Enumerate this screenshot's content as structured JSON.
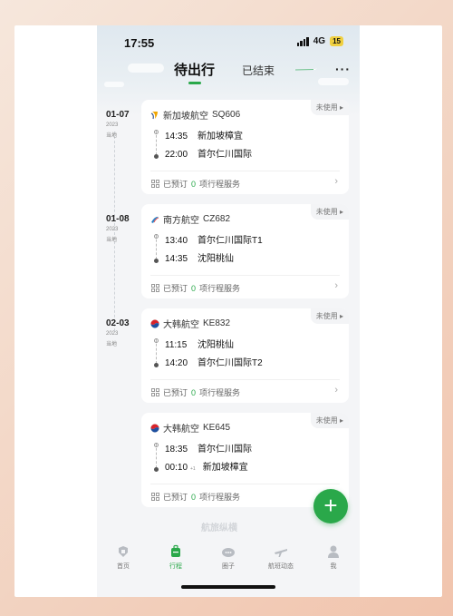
{
  "status": {
    "time": "17:55",
    "network": "4G",
    "battery": "15"
  },
  "tabs": {
    "active": "待出行",
    "inactive": "已结束"
  },
  "days": [
    {
      "date": "01-07",
      "year": "2023",
      "local": "当地"
    },
    {
      "date": "01-08",
      "year": "2023",
      "local": "当地"
    },
    {
      "date": "02-03",
      "year": "2023",
      "local": "当地"
    }
  ],
  "trips": [
    {
      "airline": "新加坡航空",
      "flight_no": "SQ606",
      "status": "未使用",
      "dep_time": "14:35",
      "dep_airport": "新加坡樟宜",
      "arr_time": "22:00",
      "arr_airport": "首尔仁川国际",
      "plus_day": "",
      "booked_label": "已预订",
      "booked_count": "0",
      "service_label": "项行程服务"
    },
    {
      "airline": "南方航空",
      "flight_no": "CZ682",
      "status": "未使用",
      "dep_time": "13:40",
      "dep_airport": "首尔仁川国际T1",
      "arr_time": "14:35",
      "arr_airport": "沈阳桃仙",
      "plus_day": "",
      "booked_label": "已预订",
      "booked_count": "0",
      "service_label": "项行程服务"
    },
    {
      "airline": "大韩航空",
      "flight_no": "KE832",
      "status": "未使用",
      "dep_time": "11:15",
      "dep_airport": "沈阳桃仙",
      "arr_time": "14:20",
      "arr_airport": "首尔仁川国际T2",
      "plus_day": "",
      "booked_label": "已预订",
      "booked_count": "0",
      "service_label": "项行程服务"
    },
    {
      "airline": "大韩航空",
      "flight_no": "KE645",
      "status": "未使用",
      "dep_time": "18:35",
      "dep_airport": "首尔仁川国际",
      "arr_time": "00:10",
      "arr_airport": "新加坡樟宜",
      "plus_day": "+1",
      "booked_label": "已预订",
      "booked_count": "0",
      "service_label": "项行程服务"
    }
  ],
  "watermark": "航旅纵横",
  "fab": "+",
  "bottom_nav": [
    {
      "label": "首页",
      "icon": "home-icon"
    },
    {
      "label": "行程",
      "icon": "luggage-icon"
    },
    {
      "label": "圈子",
      "icon": "circle-icon"
    },
    {
      "label": "航班动态",
      "icon": "plane-icon"
    },
    {
      "label": "我",
      "icon": "person-icon"
    }
  ],
  "colors": {
    "accent": "#2aa84a",
    "background": "#f4f5f7",
    "card": "#ffffff"
  }
}
